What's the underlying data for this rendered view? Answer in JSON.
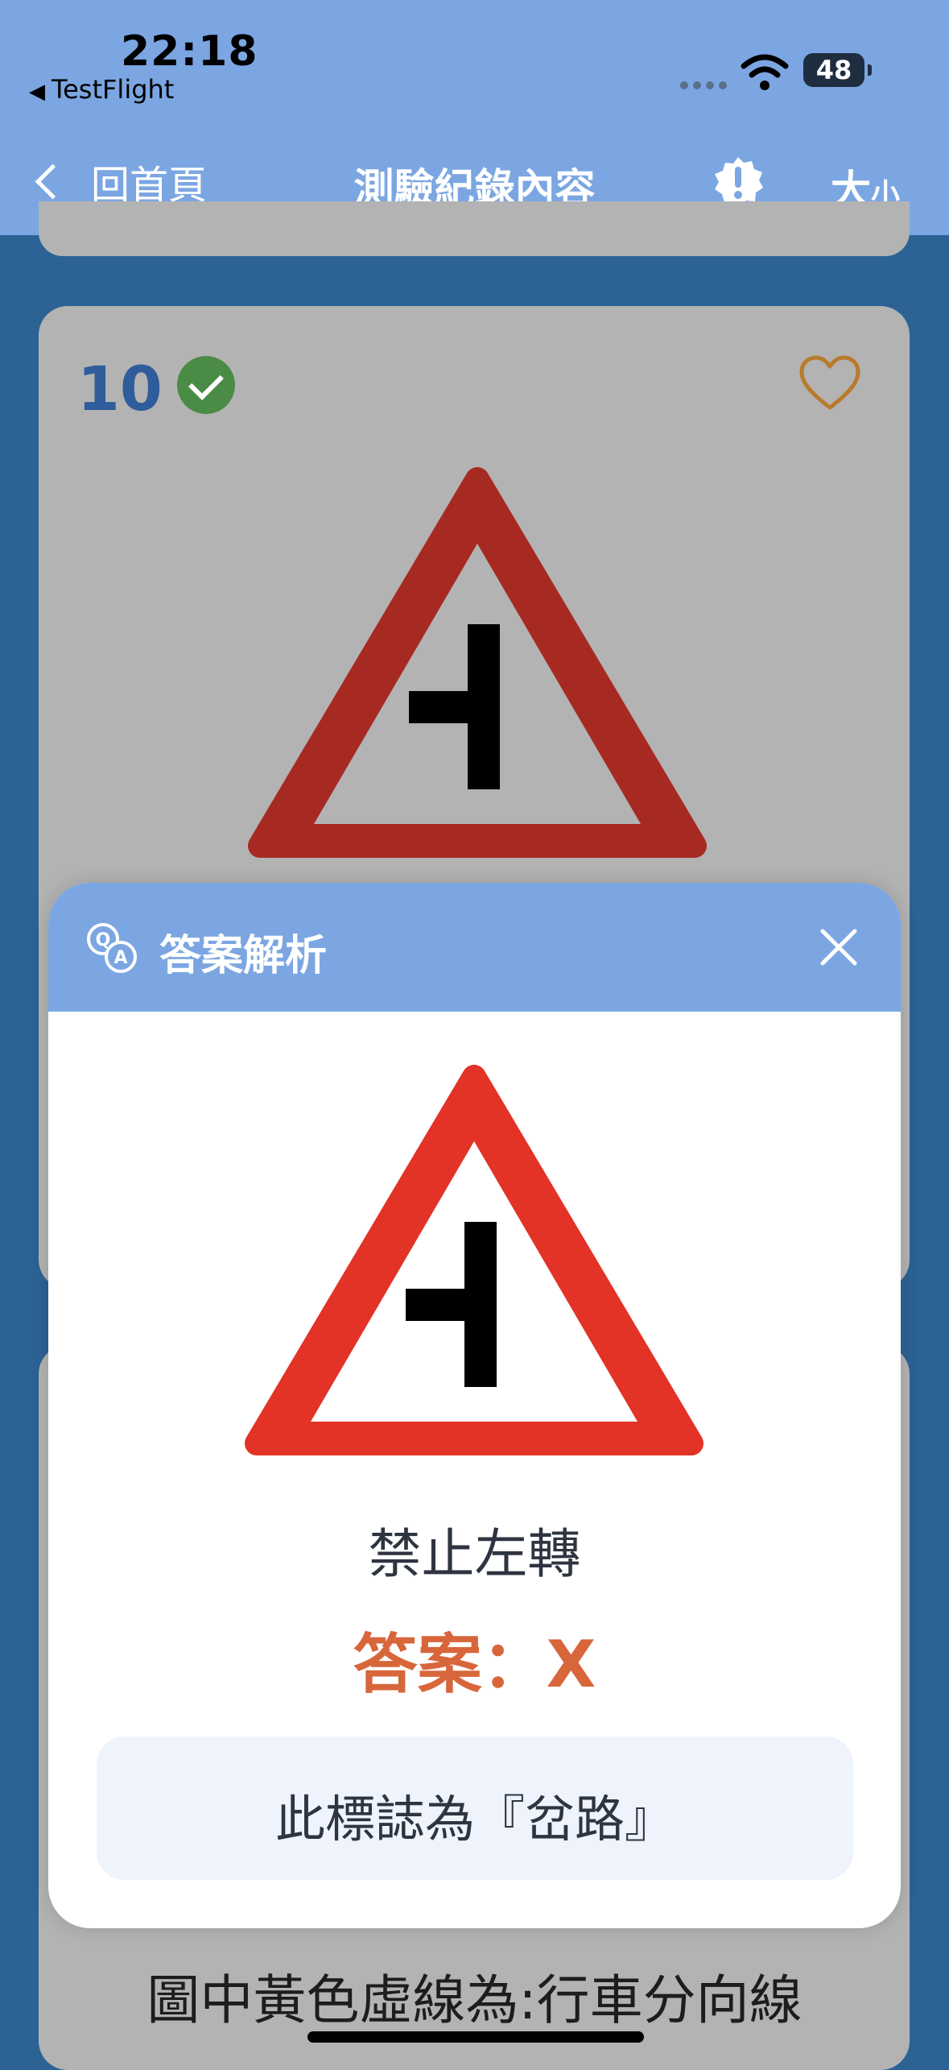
{
  "status_bar": {
    "time": "22:18",
    "back_app": "TestFlight",
    "battery": "48"
  },
  "nav": {
    "back_label": "回首頁",
    "title": "測驗紀錄內容",
    "font_large": "大",
    "font_small": "小"
  },
  "card": {
    "number": "10",
    "status": "correct",
    "sign": "side-road-warning"
  },
  "modal": {
    "title": "答案解析",
    "question": "禁止左轉",
    "answer": "答案：X",
    "explanation": "此標誌為『岔路』"
  },
  "next_card": {
    "question": "圖中黃色虛線為:行車分向線"
  },
  "colors": {
    "header_bg": "#7ba6e2",
    "page_bg": "#2c6294",
    "answer_color": "#d8663b",
    "check_green": "#4a8b45",
    "heart_outline": "#b87a2c"
  }
}
